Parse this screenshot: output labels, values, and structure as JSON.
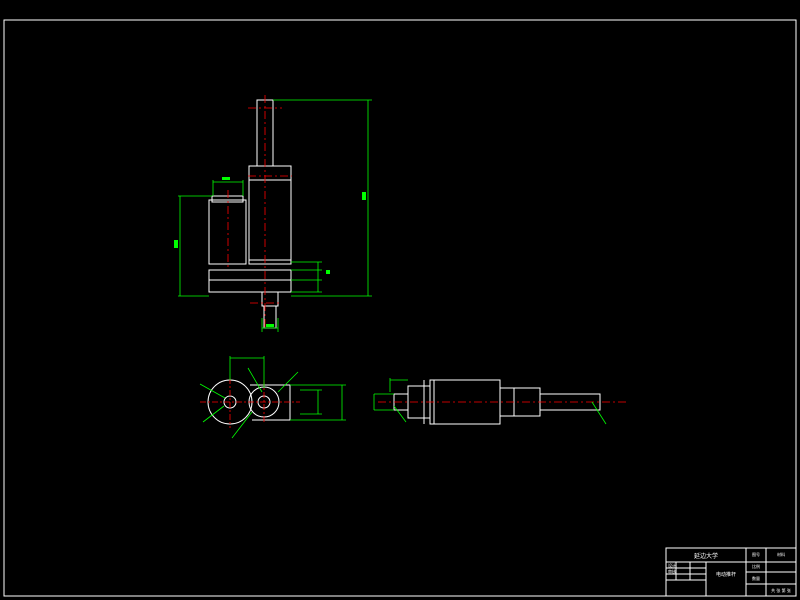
{
  "colors": {
    "background": "#000000",
    "outline": "#ffffff",
    "dimension": "#00ff00",
    "centerline": "#ff0000"
  },
  "title_block": {
    "university": "延边大学",
    "drawing_title": "电动推杆",
    "row_labels": [
      "设计",
      "审核"
    ],
    "field_1": "图号",
    "field_2": "材料",
    "field_3": "比例",
    "field_4": "数量",
    "field_5": "共 张 第 张"
  },
  "dimensions": {
    "overall_height": "",
    "motor_height": "",
    "base_width": "",
    "link_width": ""
  }
}
